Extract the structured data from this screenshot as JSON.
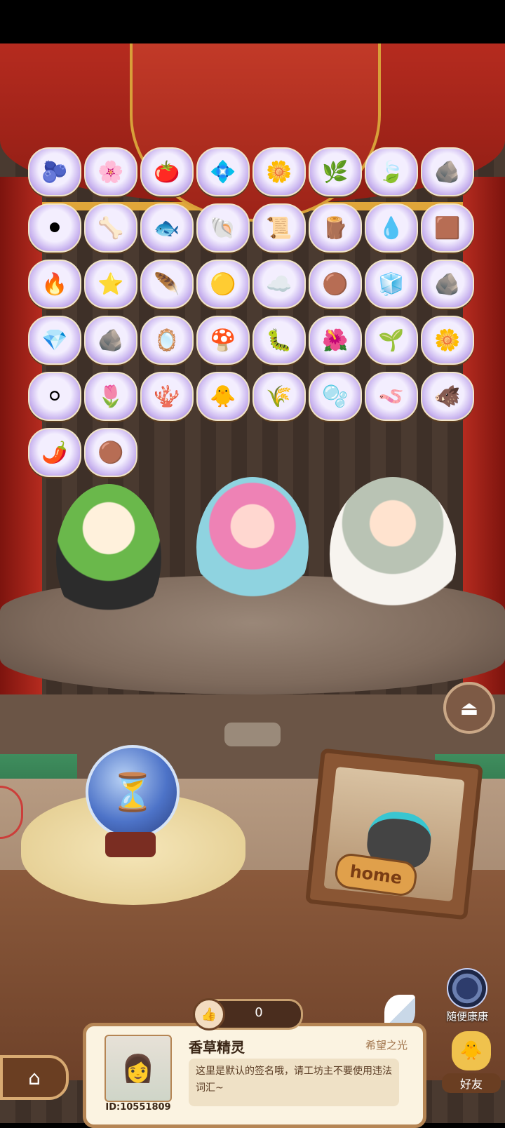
{
  "stage": {
    "items": [
      {
        "icon": "🫐"
      },
      {
        "icon": "🌸"
      },
      {
        "icon": "🍅"
      },
      {
        "icon": "💠"
      },
      {
        "icon": "🌼"
      },
      {
        "icon": "🌿"
      },
      {
        "icon": "🍃"
      },
      {
        "icon": "🪨"
      },
      {
        "icon": "⚫"
      },
      {
        "icon": "🦴"
      },
      {
        "icon": "🐟"
      },
      {
        "icon": "🐚"
      },
      {
        "icon": "📜"
      },
      {
        "icon": "🪵"
      },
      {
        "icon": "💧"
      },
      {
        "icon": "🟫"
      },
      {
        "icon": "🔥"
      },
      {
        "icon": "⭐"
      },
      {
        "icon": "🪶"
      },
      {
        "icon": "🟡"
      },
      {
        "icon": "☁️"
      },
      {
        "icon": "🟤"
      },
      {
        "icon": "🧊"
      },
      {
        "icon": "🪨"
      },
      {
        "icon": "💎"
      },
      {
        "icon": "🪨"
      },
      {
        "icon": "🪞"
      },
      {
        "icon": "🍄"
      },
      {
        "icon": "🐛"
      },
      {
        "icon": "🌺"
      },
      {
        "icon": "🌱"
      },
      {
        "icon": "🌼"
      },
      {
        "icon": "⚪"
      },
      {
        "icon": "🌷"
      },
      {
        "icon": "🪸"
      },
      {
        "icon": "🐥"
      },
      {
        "icon": "🌾"
      },
      {
        "icon": "🫧"
      },
      {
        "icon": "🪱"
      },
      {
        "icon": "🐗"
      },
      {
        "icon": "🌶️"
      },
      {
        "icon": "🟤"
      }
    ]
  },
  "share_icon": "⏏",
  "hourglass_icon": "⏳",
  "frame": {
    "label": "home"
  },
  "random_visit": {
    "label": "随便康康",
    "icon": "swirl-icon"
  },
  "likes": {
    "thumb": "👍",
    "count": "0"
  },
  "profile": {
    "nickname": "香草精灵",
    "title": "希望之光",
    "signature": "这里是默认的签名哦，请工坊主不要使用违法词汇~",
    "id": "ID:10551809",
    "avatar": "👩"
  },
  "nav": {
    "home_icon": "⌂",
    "friends_label": "好友",
    "friends_icon": "🐥"
  }
}
